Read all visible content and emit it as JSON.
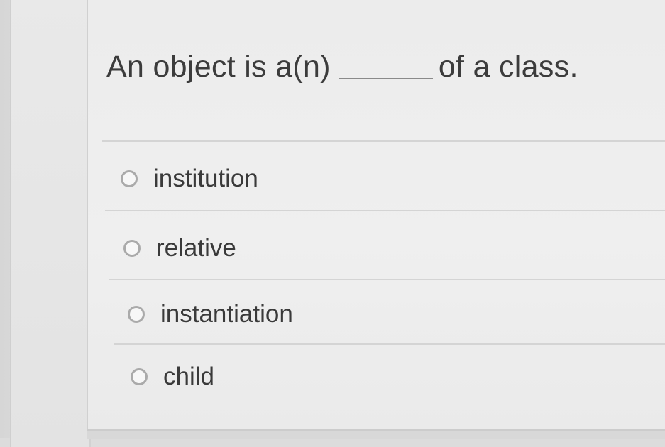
{
  "question": {
    "before_blank": "An object is a(n)",
    "after_blank": "of a class."
  },
  "options": [
    {
      "label": "institution",
      "selected": false
    },
    {
      "label": "relative",
      "selected": false
    },
    {
      "label": "instantiation",
      "selected": false
    },
    {
      "label": "child",
      "selected": false
    }
  ]
}
